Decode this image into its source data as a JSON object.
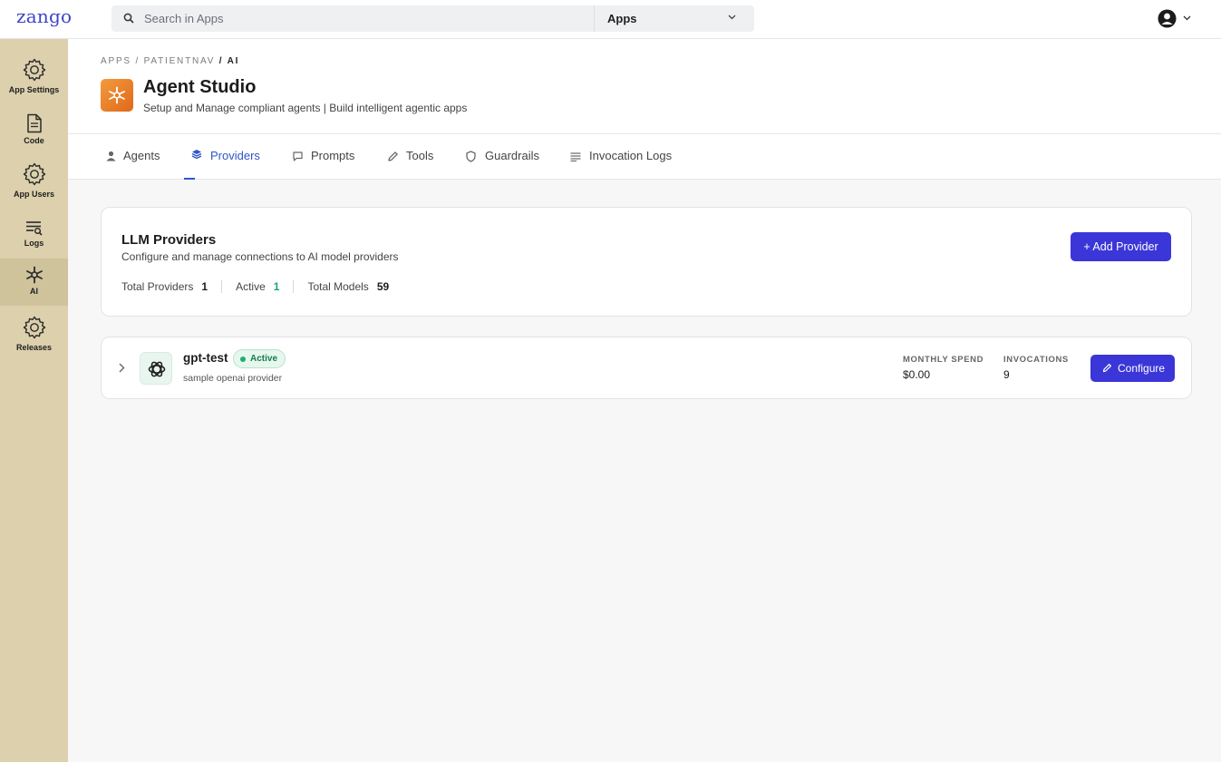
{
  "app": {
    "logo_text": "zango",
    "search_placeholder": "Search in Apps",
    "scope_selected": "Apps",
    "brand_color": "#3b44c4",
    "accent_color": "#3b36d8",
    "sidebar_bg": "#dcd0ad"
  },
  "sidebar": {
    "items": [
      {
        "label": "App Settings",
        "icon": "gear-icon"
      },
      {
        "label": "Code",
        "icon": "file-icon"
      },
      {
        "label": "App Users",
        "icon": "gear-icon"
      },
      {
        "label": "Logs",
        "icon": "list-search-icon"
      },
      {
        "label": "AI",
        "icon": "sparkle-icon",
        "active": true
      },
      {
        "label": "Releases",
        "icon": "gear-icon"
      }
    ]
  },
  "header": {
    "breadcrumb": [
      "APPS",
      "PATIENTNAV",
      "AI"
    ],
    "breadcrumb_sep": " / ",
    "title": "Agent Studio",
    "subtitle": "Setup and Manage compliant agents | Build intelligent agentic apps"
  },
  "tabs": [
    {
      "label": "Agents",
      "icon": "user-icon"
    },
    {
      "label": "Providers",
      "icon": "cube-icon",
      "active": true
    },
    {
      "label": "Prompts",
      "icon": "chat-icon"
    },
    {
      "label": "Tools",
      "icon": "pencil-icon"
    },
    {
      "label": "Guardrails",
      "icon": "shield-icon"
    },
    {
      "label": "Invocation Logs",
      "icon": "lines-icon"
    }
  ],
  "llm_card": {
    "title": "LLM Providers",
    "description": "Configure and manage connections to AI model providers",
    "add_button": "+ Add Provider",
    "stats": {
      "total_providers_label": "Total Providers",
      "total_providers": "1",
      "active_label": "Active",
      "active": "1",
      "total_models_label": "Total Models",
      "total_models": "59"
    }
  },
  "providers": [
    {
      "name": "gpt-test",
      "status": "Active",
      "description": "sample openai provider",
      "monthly_spend_label": "MONTHLY SPEND",
      "monthly_spend": "$0.00",
      "invocations_label": "INVOCATIONS",
      "invocations": "9",
      "configure_label": "Configure",
      "logo_icon": "openai-icon"
    }
  ]
}
